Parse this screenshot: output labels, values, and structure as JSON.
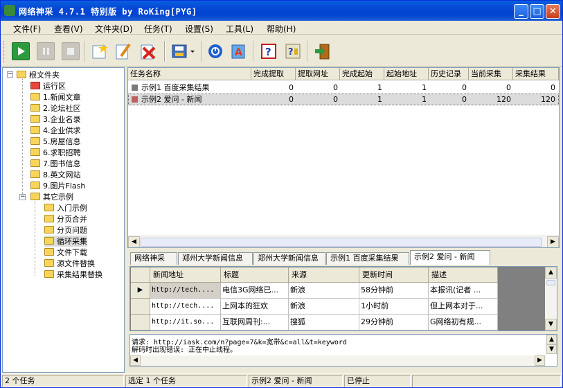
{
  "window": {
    "title": "网络神采 4.7.1 特别版 by RoKing[PYG]"
  },
  "menu": [
    "文件(F)",
    "查看(V)",
    "文件夹(D)",
    "任务(T)",
    "设置(S)",
    "工具(L)",
    "帮助(H)"
  ],
  "toolbar_icons": [
    "start-icon",
    "pause-icon",
    "stop-icon",
    "new-task-icon",
    "edit-task-icon",
    "delete-task-icon",
    "save-icon",
    "dropdown-arrow-icon",
    "info-icon",
    "auto-icon",
    "help-icon",
    "about-icon",
    "exit-icon"
  ],
  "tree": {
    "root": "根文件夹",
    "items": [
      "运行区",
      "1.新闻文章",
      "2.论坛社区",
      "3.企业名录",
      "4.企业供求",
      "5.房屋信息",
      "6.求职招聘",
      "7.图书信息",
      "8.英文网站",
      "9.图片Flash",
      "其它示例"
    ],
    "sub_items": [
      "入门示例",
      "分页合并",
      "分页问题",
      "循环采集",
      "文件下载",
      "源文件替换",
      "采集结果替换"
    ]
  },
  "tasks": {
    "columns": [
      "任务名称",
      "完成提取",
      "提取网址",
      "完成起始",
      "起始地址",
      "历史记录",
      "当前采集",
      "采集结果"
    ],
    "rows": [
      {
        "name": "示例1 百度采集结果",
        "c1": "0",
        "c2": "0",
        "c3": "1",
        "c4": "1",
        "c5": "0",
        "c6": "0",
        "c7": "0"
      },
      {
        "name": "示例2 爱问 - 新闻",
        "c1": "0",
        "c2": "0",
        "c3": "1",
        "c4": "1",
        "c5": "0",
        "c6": "120",
        "c7": "120"
      }
    ]
  },
  "tabs": [
    "网络神采",
    "郑州大学新闻信息",
    "郑州大学新闻信息",
    "示例1 百度采集结果",
    "示例2 爱问 - 新闻"
  ],
  "results": {
    "columns": [
      "新闻地址",
      "标题",
      "来源",
      "更新时间",
      "描述"
    ],
    "rows": [
      {
        "url": "http://tech....",
        "title": "电信3G网络已...",
        "source": "新浪",
        "time": "58分钟前",
        "desc": "本报讯(记者 ..."
      },
      {
        "url": "http://tech....",
        "title": "上网本的狂欢",
        "source": "新浪",
        "time": "1小时前",
        "desc": "但上网本对于..."
      },
      {
        "url": "http://it.so...",
        "title": "互联网周刊:...",
        "source": "搜狐",
        "time": "29分钟前",
        "desc": "G网络初有规..."
      }
    ]
  },
  "log": {
    "line1": "请求: http://iask.com/n?page=7&k=宽带&c=all&t=keyword",
    "line2": "解码时出现错误: 正在中止线程。"
  },
  "status": {
    "count": "2 个任务",
    "selected": "选定 1 个任务",
    "current": "示例2 爱问 - 新闻",
    "state": "已停止"
  }
}
